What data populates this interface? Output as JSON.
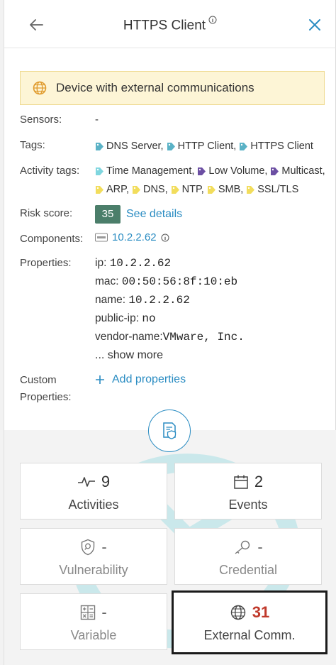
{
  "header": {
    "title": "HTTPS Client",
    "back_icon": "arrow-left-icon",
    "close_icon": "close-icon"
  },
  "banner": {
    "text": "Device with external communications",
    "icon": "globe-icon"
  },
  "fields": {
    "sensors_label": "Sensors:",
    "sensors_value": "-",
    "tags_label": "Tags:",
    "tags": [
      "DNS Server,",
      "HTTP Client,",
      "HTTPS Client"
    ],
    "activity_tags_label": "Activity tags:",
    "activity_tags_row1": [
      {
        "label": "Time Management,",
        "color": "#7fd6df"
      },
      {
        "label": "Low Volume,",
        "color": "#6c4fa3"
      },
      {
        "label": "Multicast,",
        "color": "#6c4fa3"
      }
    ],
    "activity_tags_row2": [
      {
        "label": "ARP,",
        "color": "#f2dd5c"
      },
      {
        "label": "DNS,",
        "color": "#f2dd5c"
      },
      {
        "label": "NTP,",
        "color": "#f2dd5c"
      },
      {
        "label": "SMB,",
        "color": "#f2dd5c"
      },
      {
        "label": "SSL/TLS",
        "color": "#f2dd5c"
      }
    ],
    "tag_color": "#5ab2c6",
    "risk_label": "Risk score:",
    "risk_value": "35",
    "risk_color": "#4b7e6a",
    "see_details": "See details",
    "components_label": "Components:",
    "component_name": "10.2.2.62",
    "properties_label": "Properties:",
    "properties": [
      {
        "key": "ip:",
        "value": "10.2.2.62"
      },
      {
        "key": "mac:",
        "value": "00:50:56:8f:10:eb"
      },
      {
        "key": "name:",
        "value": "10.2.2.62"
      },
      {
        "key": "public-ip:",
        "value": "no"
      },
      {
        "key": "vendor-name:",
        "value": "VMware, Inc."
      }
    ],
    "show_more": "... show more",
    "custom_label_1": "Custom",
    "custom_label_2": "Properties:",
    "add_properties": "Add properties"
  },
  "cards": {
    "activities": {
      "count": "9",
      "name": "Activities"
    },
    "events": {
      "count": "2",
      "name": "Events"
    },
    "vulnerability": {
      "count": "-",
      "name": "Vulnerability"
    },
    "credential": {
      "count": "-",
      "name": "Credential"
    },
    "variable": {
      "count": "-",
      "name": "Variable"
    },
    "external": {
      "count": "31",
      "name": "External Comm."
    }
  },
  "colors": {
    "accent": "#2a8cc2",
    "alert": "#c0392b"
  }
}
